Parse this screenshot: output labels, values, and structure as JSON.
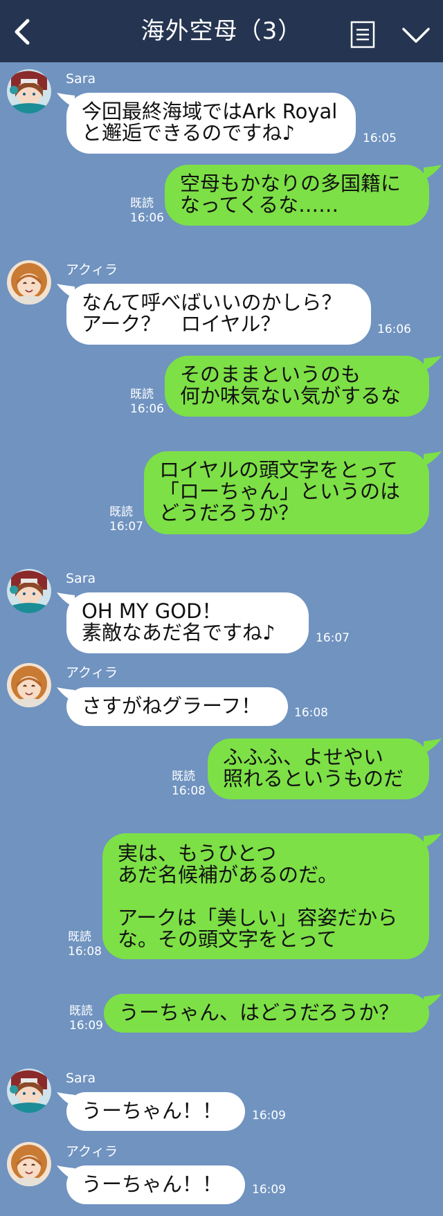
{
  "header": {
    "title": "海外空母（3）"
  },
  "colors": {
    "header_bg": "#253551",
    "chat_bg": "#7093c0",
    "incoming": "#ffffff",
    "outgoing": "#7de046"
  },
  "messages": [
    {
      "sender": "Sara",
      "text": "今回最終海域ではArk Royal\nと邂逅できるのですね♪",
      "time": "16:05"
    },
    {
      "text": "空母もかなりの多国籍に\nなってくるな……",
      "read": "既読",
      "time": "16:06"
    },
    {
      "sender": "アクィラ",
      "text": "なんて呼べばいいのかしら？\nアーク？　ロイヤル？",
      "time": "16:06"
    },
    {
      "text": "そのままというのも\n何か味気ない気がするな",
      "read": "既読",
      "time": "16:06"
    },
    {
      "text": "ロイヤルの頭文字をとって\n「ローちゃん」というのは\nどうだろうか？",
      "read": "既読",
      "time": "16:07"
    },
    {
      "sender": "Sara",
      "text": "OH MY GOD！\n素敵なあだ名ですね♪",
      "time": "16:07"
    },
    {
      "sender": "アクィラ",
      "text": "さすがねグラーフ！",
      "time": "16:08"
    },
    {
      "text": "ふふふ、よせやい\n照れるというものだ",
      "read": "既読",
      "time": "16:08"
    },
    {
      "text": "実は、もうひとつ\nあだ名候補があるのだ。\n\nアークは「美しい」容姿だから\nな。その頭文字をとって",
      "read": "既読",
      "time": "16:08"
    },
    {
      "text": "うーちゃん、はどうだろうか？",
      "read": "既読",
      "time": "16:09"
    },
    {
      "sender": "Sara",
      "text": "うーちゃん！！",
      "time": "16:09"
    },
    {
      "sender": "アクィラ",
      "text": "うーちゃん！！",
      "time": "16:09"
    }
  ]
}
